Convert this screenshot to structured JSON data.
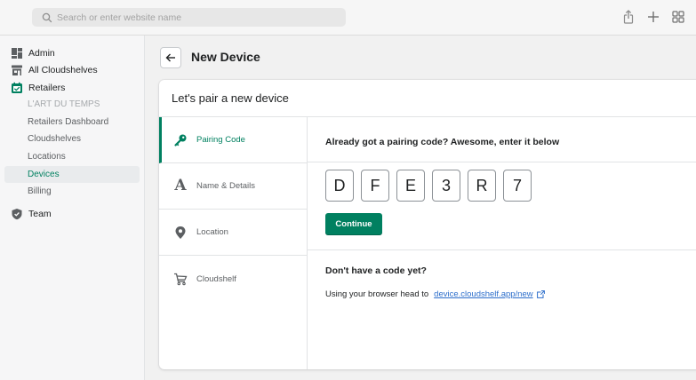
{
  "browser": {
    "url_placeholder": "Search or enter website name",
    "icons": [
      "search-icon",
      "share-icon",
      "plus-icon",
      "tab-grid-icon"
    ]
  },
  "sidebar": {
    "admin": "Admin",
    "all_cloudshelves": "All Cloudshelves",
    "retailers": "Retailers",
    "retailer_name": "L'ART DU TEMPS",
    "items": [
      {
        "label": "Retailers Dashboard"
      },
      {
        "label": "Cloudshelves"
      },
      {
        "label": "Locations"
      },
      {
        "label": "Devices"
      },
      {
        "label": "Billing"
      }
    ],
    "active_item": "Devices",
    "team": "Team"
  },
  "page": {
    "title": "New Device",
    "card_title": "Let's pair a new device"
  },
  "steps": [
    {
      "label": "Pairing Code",
      "icon": "key-icon"
    },
    {
      "label": "Name & Details",
      "icon": "font-a-icon"
    },
    {
      "label": "Location",
      "icon": "location-pin-icon"
    },
    {
      "label": "Cloudshelf",
      "icon": "cart-icon"
    }
  ],
  "active_step": "Pairing Code",
  "pairing": {
    "prompt": "Already got a pairing code? Awesome, enter it below",
    "code": [
      "D",
      "F",
      "E",
      "3",
      "R",
      "7"
    ],
    "continue_label": "Continue",
    "no_code_heading": "Don't have a code yet?",
    "help_text": "Using your browser head to",
    "help_link": "device.cloudshelf.app/new"
  },
  "colors": {
    "accent": "#008060",
    "link": "#2c6ecb",
    "sidebar_bg": "#f6f6f7",
    "page_bg": "#f1f1f1"
  }
}
